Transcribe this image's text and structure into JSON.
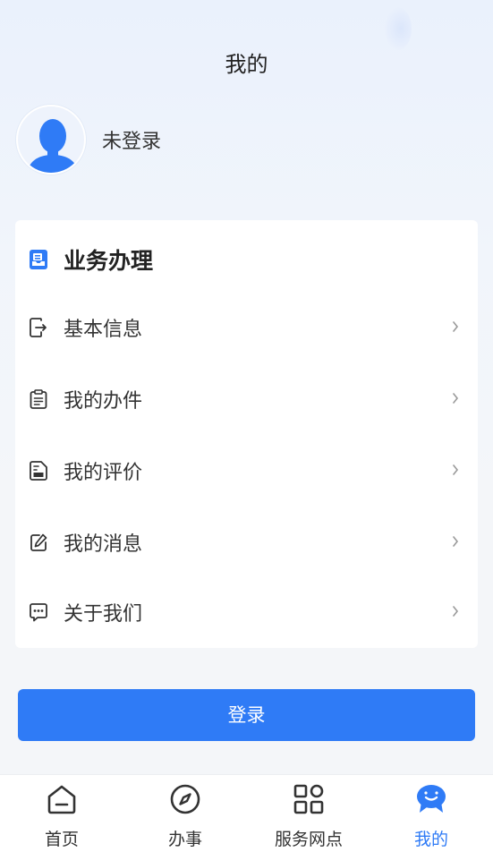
{
  "header": {
    "title": "我的"
  },
  "profile": {
    "status": "未登录"
  },
  "card": {
    "title": "业务办理",
    "items": [
      {
        "label": "基本信息",
        "icon": "id-card-exit-icon"
      },
      {
        "label": "我的办件",
        "icon": "clipboard-list-icon"
      },
      {
        "label": "我的评价",
        "icon": "document-text-icon"
      },
      {
        "label": "我的消息",
        "icon": "edit-square-icon"
      },
      {
        "label": "关于我们",
        "icon": "chat-bubble-dots-icon"
      }
    ]
  },
  "login_button": {
    "label": "登录"
  },
  "tabbar": {
    "tabs": [
      {
        "label": "首页",
        "icon": "home-icon"
      },
      {
        "label": "办事",
        "icon": "compass-icon"
      },
      {
        "label": "服务网点",
        "icon": "grid-icon"
      },
      {
        "label": "我的",
        "icon": "mascot-icon",
        "active": true
      }
    ]
  },
  "colors": {
    "accent": "#2f7bf6",
    "text": "#333333",
    "background": "#f4f6f9"
  }
}
